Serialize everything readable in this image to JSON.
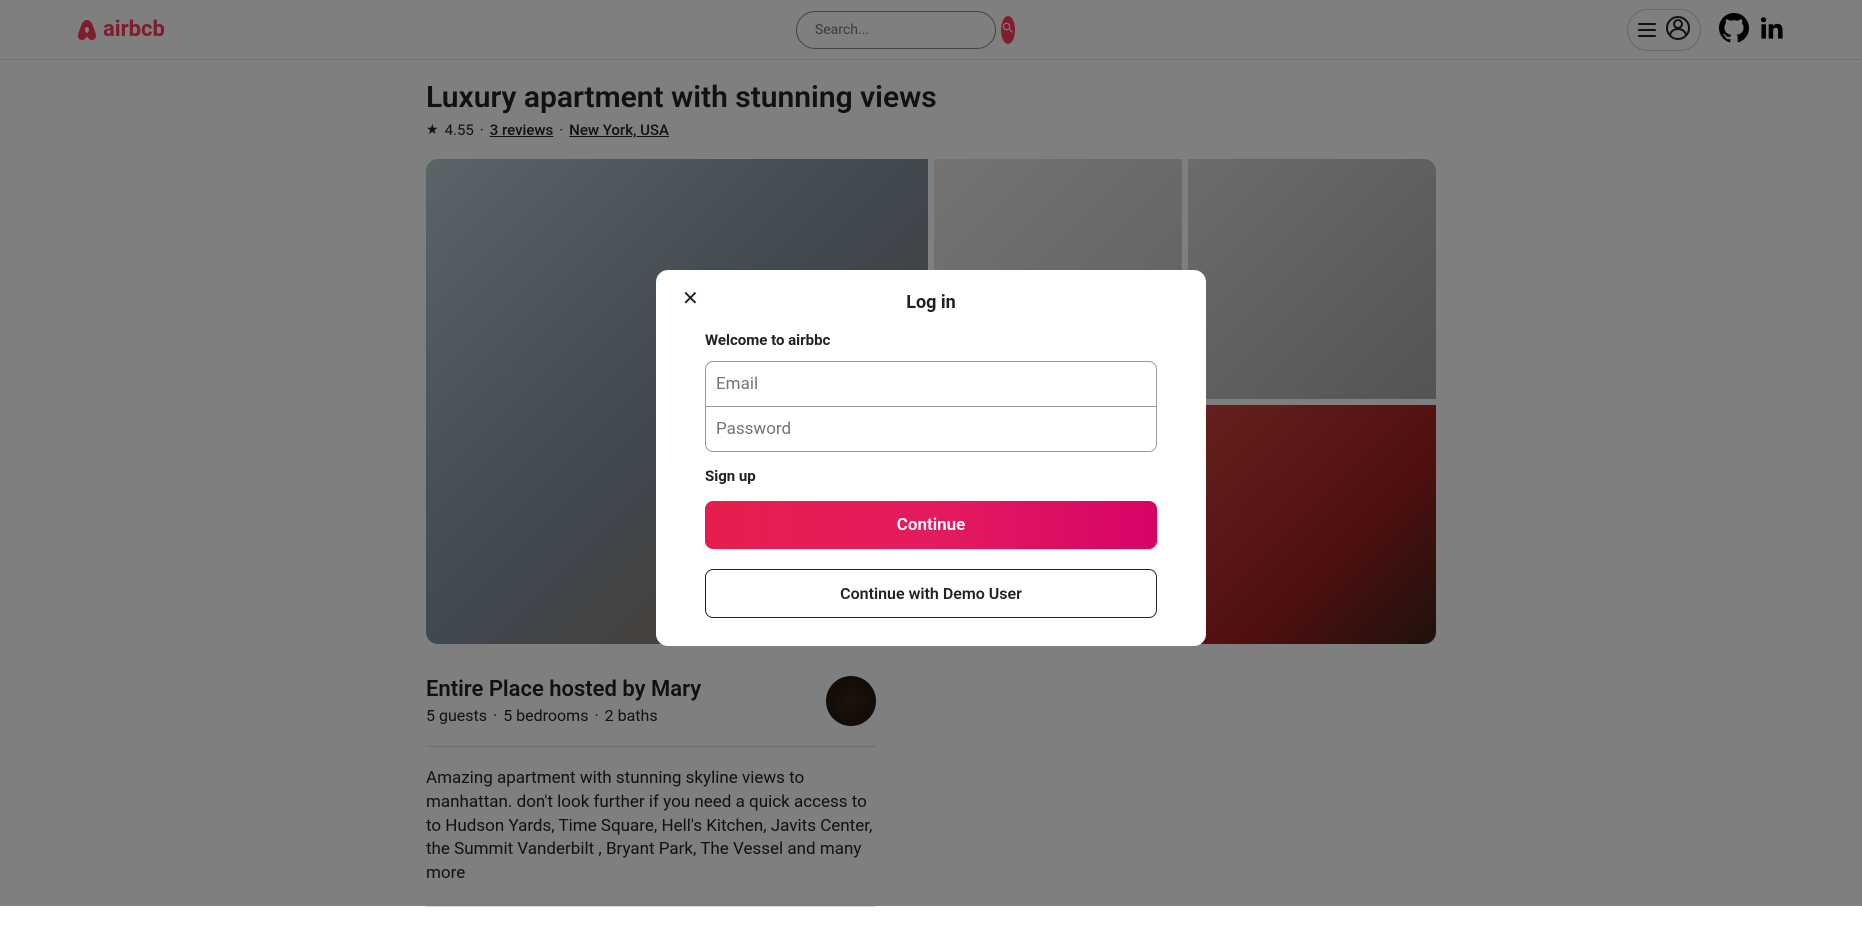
{
  "header": {
    "logo_text": "airbcb",
    "search_placeholder": "Search..."
  },
  "listing": {
    "title": "Luxury apartment with stunning views",
    "rating": "4.55",
    "reviews_text": "3 reviews",
    "location": "New York, USA"
  },
  "host": {
    "title": "Entire Place hosted by Mary",
    "guests": "5 guests",
    "bedrooms": "5 bedrooms",
    "baths": "2 baths"
  },
  "description": "Amazing apartment with stunning skyline views to manhattan. don't look further if you need a quick access to to Hudson Yards, Time Square, Hell's Kitchen, Javits Center, the Summit Vanderbilt , Bryant Park, The Vessel and many more",
  "modal": {
    "title": "Log in",
    "subtitle": "Welcome to airbbc",
    "email_placeholder": "Email",
    "password_placeholder": "Password",
    "signup_text": "Sign up",
    "continue_text": "Continue",
    "demo_text": "Continue with Demo User"
  }
}
